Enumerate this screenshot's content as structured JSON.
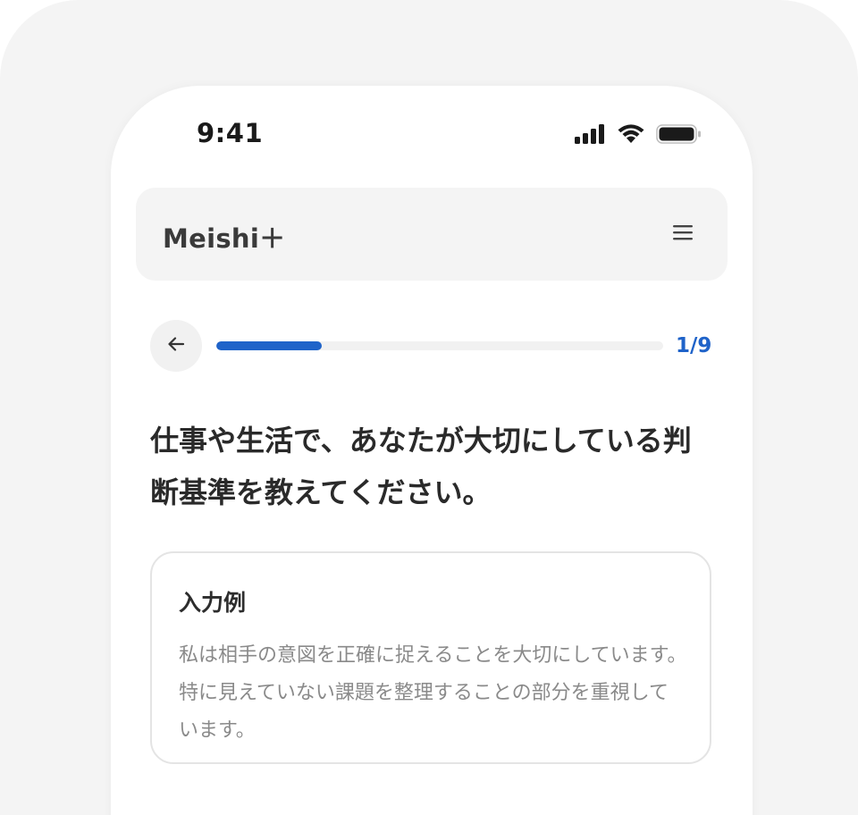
{
  "status_bar": {
    "time": "9:41",
    "icons": [
      "signal-icon",
      "wifi-icon",
      "battery-icon"
    ]
  },
  "header": {
    "logo": "Meishi＋",
    "menu_icon": "hamburger-menu-icon"
  },
  "progress": {
    "back_icon": "arrow-left-icon",
    "current": 1,
    "total": 9,
    "label": "1/9",
    "fraction": 0.2364,
    "accent_color": "#1f63c9"
  },
  "question": {
    "text": "仕事や生活で、あなたが大切にしている判断基準を教えてください。"
  },
  "example": {
    "title": "入力例",
    "body": "私は相手の意図を正確に捉えることを大切にしています。特に見えていない課題を整理することの部分を重視しています。"
  }
}
